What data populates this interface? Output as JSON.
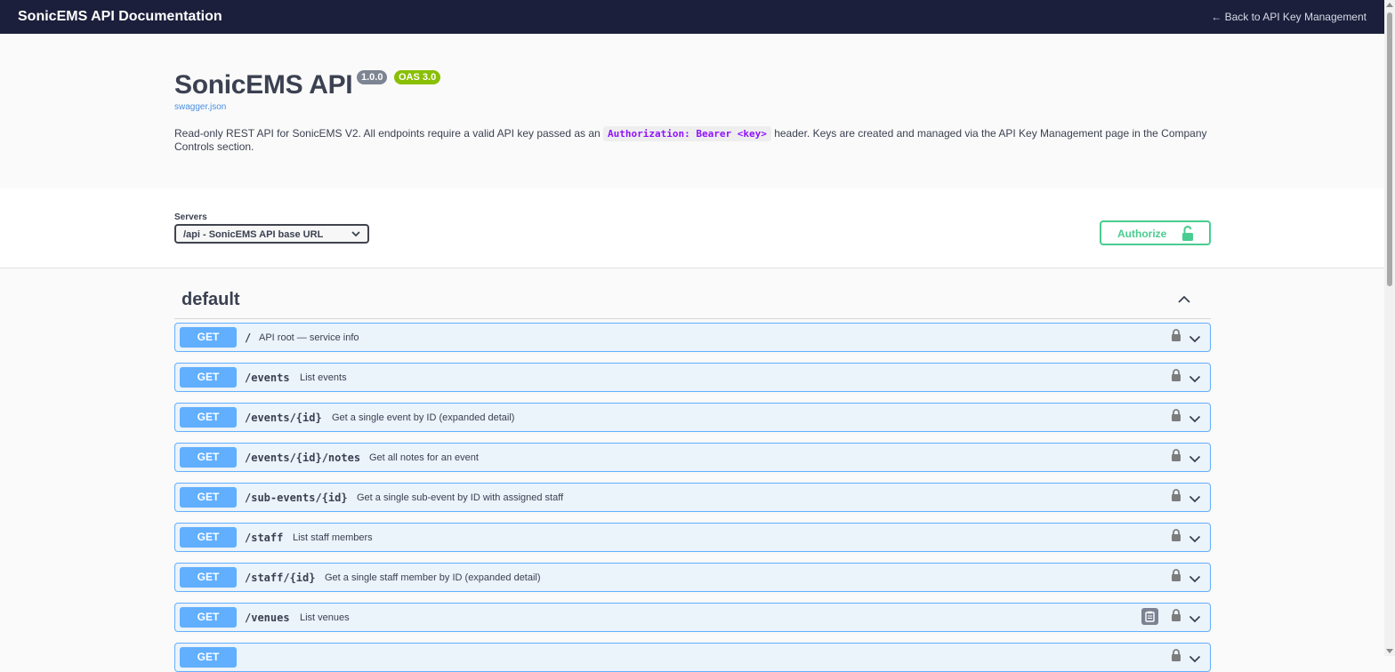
{
  "topbar": {
    "title": "SonicEMS API Documentation",
    "back_link": "← Back to API Key Management"
  },
  "info": {
    "title": "SonicEMS API",
    "version_badge": "1.0.0",
    "oas_badge": "OAS 3.0",
    "spec_link": "swagger.json",
    "desc_before": "Read-only REST API for SonicEMS V2. All endpoints require a valid API key passed as an ",
    "desc_code": "Authorization: Bearer <key>",
    "desc_after": " header. Keys are created and managed via the API Key Management page in the Company Controls section."
  },
  "servers": {
    "label": "Servers",
    "selected": "/api - SonicEMS API base URL",
    "authorize_label": "Authorize"
  },
  "tag": {
    "name": "default"
  },
  "operations": [
    {
      "method": "GET",
      "path": "/",
      "summary": "API root — service info"
    },
    {
      "method": "GET",
      "path": "/events",
      "summary": "List events"
    },
    {
      "method": "GET",
      "path": "/events/{id}",
      "summary": "Get a single event by ID (expanded detail)"
    },
    {
      "method": "GET",
      "path": "/events/{id}/notes",
      "summary": "Get all notes for an event"
    },
    {
      "method": "GET",
      "path": "/sub-events/{id}",
      "summary": "Get a single sub-event by ID with assigned staff"
    },
    {
      "method": "GET",
      "path": "/staff",
      "summary": "List staff members"
    },
    {
      "method": "GET",
      "path": "/staff/{id}",
      "summary": "Get a single staff member by ID (expanded detail)"
    },
    {
      "method": "GET",
      "path": "/venues",
      "summary": "List venues"
    },
    {
      "method": "GET",
      "path": "",
      "summary": ""
    }
  ],
  "icons": {
    "lock": "lock-icon",
    "chevron": "chevron-down-icon",
    "copy": "copy-to-clipboard-icon",
    "collapse": "chevron-up-icon",
    "unlock": "unlock-icon"
  },
  "colors": {
    "topbar": "#1b1f3b",
    "get": "#61affe",
    "get_bg": "#ebf3fb",
    "authorize": "#49cc90",
    "version_badge": "#7d8492",
    "oas_badge": "#89bf04",
    "code": "#9012fe"
  }
}
